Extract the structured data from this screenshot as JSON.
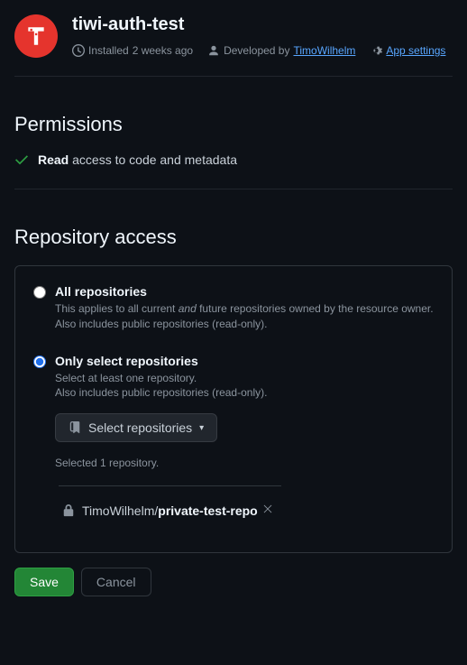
{
  "header": {
    "title": "tiwi-auth-test",
    "installed_prefix": "Installed ",
    "installed_when": "2 weeks ago",
    "developed_prefix": "Developed by ",
    "developer": "TimoWilhelm",
    "settings_link": "App settings"
  },
  "permissions": {
    "heading": "Permissions",
    "item_strong": "Read",
    "item_rest": " access to code and metadata"
  },
  "access": {
    "heading": "Repository access",
    "all": {
      "title": "All repositories",
      "sub_pre": "This applies to all current ",
      "sub_em": "and",
      "sub_post": " future repositories owned by the resource owner.",
      "sub_line2": "Also includes public repositories (read-only)."
    },
    "select": {
      "title": "Only select repositories",
      "sub1": "Select at least one repository.",
      "sub2": "Also includes public repositories (read-only).",
      "button_label": "Select repositories",
      "selected_label": "Selected 1 repository."
    },
    "repo": {
      "owner": "TimoWilhelm/",
      "name": "private-test-repo"
    }
  },
  "buttons": {
    "save": "Save",
    "cancel": "Cancel"
  }
}
